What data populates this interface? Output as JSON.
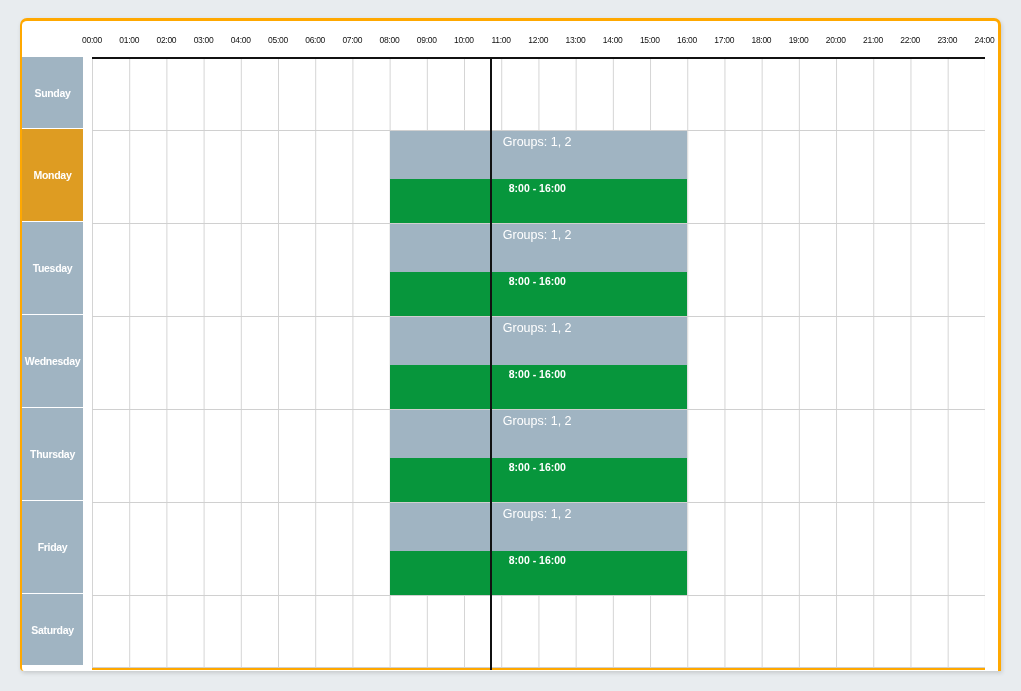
{
  "hours": [
    "00:00",
    "01:00",
    "02:00",
    "03:00",
    "04:00",
    "05:00",
    "06:00",
    "07:00",
    "08:00",
    "09:00",
    "10:00",
    "11:00",
    "12:00",
    "13:00",
    "14:00",
    "15:00",
    "16:00",
    "17:00",
    "18:00",
    "19:00",
    "20:00",
    "21:00",
    "22:00",
    "23:00",
    "24:00"
  ],
  "days": [
    {
      "label": "Sunday",
      "selected": false
    },
    {
      "label": "Monday",
      "selected": true,
      "events": [
        {
          "title": "Groups: 1, 2",
          "time": "8:00 - 16:00"
        }
      ]
    },
    {
      "label": "Tuesday",
      "selected": false,
      "events": [
        {
          "title": "Groups: 1, 2",
          "time": "8:00 - 16:00"
        }
      ]
    },
    {
      "label": "Wednesday",
      "selected": false,
      "events": [
        {
          "title": "Groups: 1, 2",
          "time": "8:00 - 16:00"
        }
      ]
    },
    {
      "label": "Thursday",
      "selected": false,
      "events": [
        {
          "title": "Groups: 1, 2",
          "time": "8:00 - 16:00"
        }
      ]
    },
    {
      "label": "Friday",
      "selected": false,
      "events": [
        {
          "title": "Groups: 1, 2",
          "time": "8:00 - 16:00"
        }
      ]
    },
    {
      "label": "Saturday",
      "selected": false
    }
  ],
  "now_line": {
    "level": 0.447
  }
}
